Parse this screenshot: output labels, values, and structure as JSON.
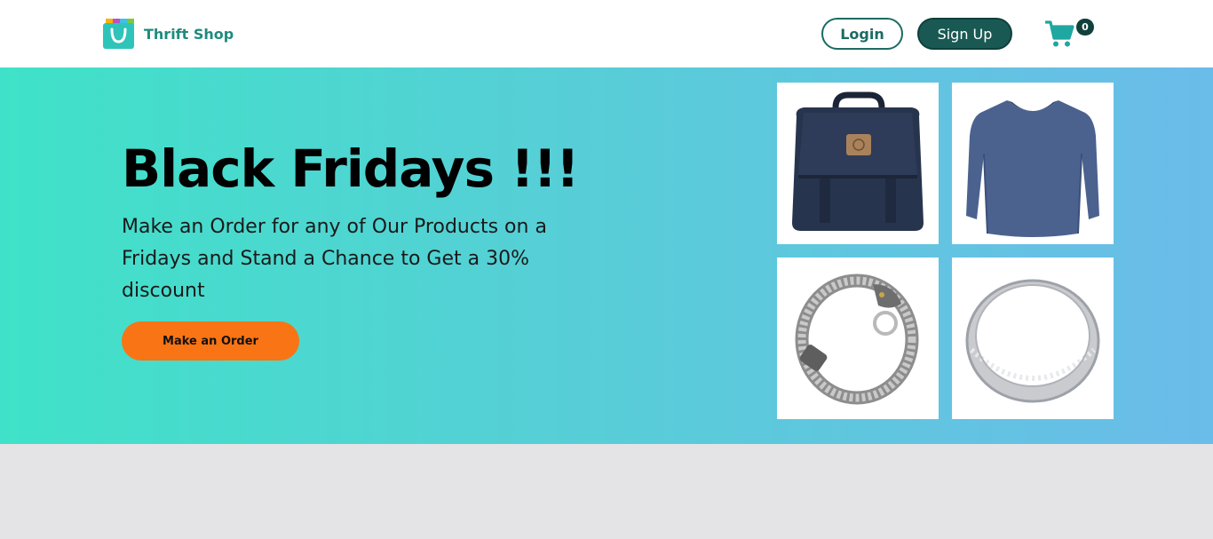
{
  "header": {
    "brand_name": "Thrift Shop",
    "login_label": "Login",
    "signup_label": "Sign Up",
    "cart_count": "0"
  },
  "hero": {
    "title": "Black Fridays !!!",
    "description": "Make an Order for any of Our Products on a Fridays and Stand a Chance to Get a 30% discount",
    "cta_label": "Make an Order"
  },
  "products": [
    {
      "icon": "backpack"
    },
    {
      "icon": "long-sleeve-shirt"
    },
    {
      "icon": "chain-bracelet"
    },
    {
      "icon": "silver-ring"
    }
  ],
  "colors": {
    "brand": "#1f8b7e",
    "signup_bg": "#1a5953",
    "cta": "#f97414",
    "cart_icon": "#1fa7a1",
    "hero_gradient_start": "#3fe2c8",
    "hero_gradient_end": "#6abce9",
    "lower_bg": "#e4e3e6"
  }
}
